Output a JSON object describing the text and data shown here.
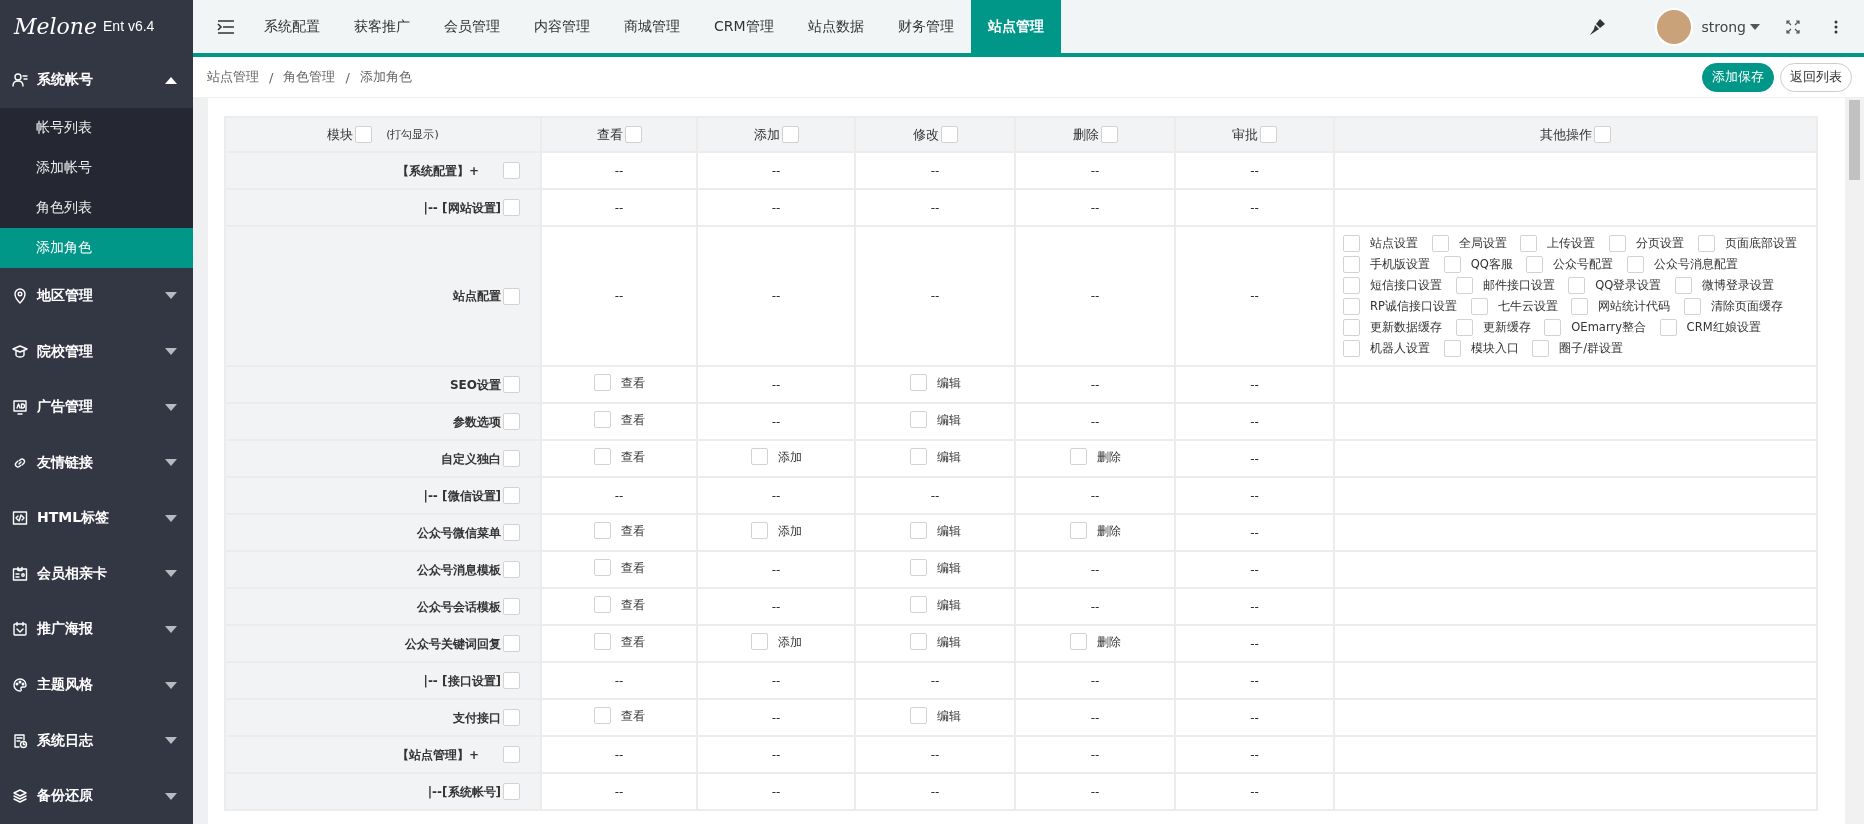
{
  "logo": {
    "script": "Melone",
    "version": "Ent v6.4"
  },
  "sidebar": {
    "items": [
      {
        "label": "系统帐号",
        "expanded": true,
        "children": [
          {
            "label": "帐号列表",
            "selected": false
          },
          {
            "label": "添加帐号",
            "selected": false
          },
          {
            "label": "角色列表",
            "selected": false
          },
          {
            "label": "添加角色",
            "selected": true
          }
        ]
      },
      {
        "label": "地区管理",
        "expanded": false
      },
      {
        "label": "院校管理",
        "expanded": false
      },
      {
        "label": "广告管理",
        "expanded": false
      },
      {
        "label": "友情链接",
        "expanded": false
      },
      {
        "label": "HTML标签",
        "expanded": false
      },
      {
        "label": "会员相亲卡",
        "expanded": false
      },
      {
        "label": "推广海报",
        "expanded": false
      },
      {
        "label": "主题风格",
        "expanded": false
      },
      {
        "label": "系统日志",
        "expanded": false
      },
      {
        "label": "备份还原",
        "expanded": false
      }
    ]
  },
  "topnav": {
    "tabs": [
      {
        "label": "系统配置",
        "selected": false
      },
      {
        "label": "获客推广",
        "selected": false
      },
      {
        "label": "会员管理",
        "selected": false
      },
      {
        "label": "内容管理",
        "selected": false
      },
      {
        "label": "商城管理",
        "selected": false
      },
      {
        "label": "CRM管理",
        "selected": false
      },
      {
        "label": "站点数据",
        "selected": false
      },
      {
        "label": "财务管理",
        "selected": false
      },
      {
        "label": "站点管理",
        "selected": true
      }
    ],
    "user": "strong"
  },
  "breadcrumb": [
    "站点管理",
    "/",
    "角色管理",
    "/",
    "添加角色"
  ],
  "buttons": [
    {
      "label": "添加保存",
      "kind": "primary"
    },
    {
      "label": "返回列表",
      "kind": "plain"
    }
  ],
  "table": {
    "columns": [
      {
        "label": "模块",
        "note": "(打勾显示)",
        "checked": false
      },
      {
        "label": "查看",
        "checked": false
      },
      {
        "label": "添加",
        "checked": false
      },
      {
        "label": "修改",
        "checked": false
      },
      {
        "label": "删除",
        "checked": false
      },
      {
        "label": "审批",
        "checked": false
      },
      {
        "label": "其他操作",
        "checked": false
      }
    ],
    "rows": [
      {
        "cells": [
          {
            "kind": "module",
            "text": "【系统配置】+",
            "group": true,
            "checked": false
          },
          {
            "kind": "dash",
            "text": "--"
          },
          {
            "kind": "dash",
            "text": "--"
          },
          {
            "kind": "dash",
            "text": "--"
          },
          {
            "kind": "dash",
            "text": "--"
          },
          {
            "kind": "dash",
            "text": "--"
          }
        ]
      },
      {
        "cells": [
          {
            "kind": "module",
            "text": "|-- [网站设置]",
            "group": false,
            "checked": false
          },
          {
            "kind": "dash",
            "text": "--"
          },
          {
            "kind": "dash",
            "text": "--"
          },
          {
            "kind": "dash",
            "text": "--"
          },
          {
            "kind": "dash",
            "text": "--"
          },
          {
            "kind": "dash",
            "text": "--"
          }
        ]
      },
      {
        "cells": [
          {
            "kind": "module",
            "text": "站点配置",
            "group": false,
            "checked": false
          },
          {
            "kind": "dash",
            "text": "--"
          },
          {
            "kind": "dash",
            "text": "--"
          },
          {
            "kind": "dash",
            "text": "--"
          },
          {
            "kind": "dash",
            "text": "--"
          },
          {
            "kind": "dash",
            "text": "--"
          },
          {
            "kind": "options",
            "options": [
              {
                "label": "站点设置",
                "checked": false
              },
              {
                "label": "全局设置",
                "checked": false
              },
              {
                "label": "上传设置",
                "checked": false
              },
              {
                "label": "分页设置",
                "checked": false
              },
              {
                "label": "页面底部设置",
                "checked": false
              },
              {
                "label": "手机版设置",
                "checked": false
              },
              {
                "label": "QQ客服",
                "checked": false
              },
              {
                "label": "公众号配置",
                "checked": false
              },
              {
                "label": "公众号消息配置",
                "checked": false
              },
              {
                "label": "短信接口设置",
                "checked": false
              },
              {
                "label": "邮件接口设置",
                "checked": false
              },
              {
                "label": "QQ登录设置",
                "checked": false
              },
              {
                "label": "微博登录设置",
                "checked": false
              },
              {
                "label": "RP诚信接口设置",
                "checked": false
              },
              {
                "label": "七牛云设置",
                "checked": false
              },
              {
                "label": "网站统计代码",
                "checked": false
              },
              {
                "label": "清除页面缓存",
                "checked": false
              },
              {
                "label": "更新数据缓存",
                "checked": false
              },
              {
                "label": "更新缓存",
                "checked": false
              },
              {
                "label": "OEmarry整合",
                "checked": false
              },
              {
                "label": "CRM红娘设置",
                "checked": false
              },
              {
                "label": "机器人设置",
                "checked": false
              },
              {
                "label": "模块入口",
                "checked": false
              },
              {
                "label": "圈子/群设置",
                "checked": false
              }
            ]
          }
        ]
      },
      {
        "cells": [
          {
            "kind": "module",
            "text": "SEO设置",
            "group": false,
            "checked": false
          },
          {
            "kind": "check",
            "label": "查看",
            "checked": false
          },
          {
            "kind": "dash",
            "text": "--"
          },
          {
            "kind": "check",
            "label": "编辑",
            "checked": false
          },
          {
            "kind": "dash",
            "text": "--"
          },
          {
            "kind": "dash",
            "text": "--"
          }
        ]
      },
      {
        "cells": [
          {
            "kind": "module",
            "text": "参数选项",
            "group": false,
            "checked": false
          },
          {
            "kind": "check",
            "label": "查看",
            "checked": false
          },
          {
            "kind": "dash",
            "text": "--"
          },
          {
            "kind": "check",
            "label": "编辑",
            "checked": false
          },
          {
            "kind": "dash",
            "text": "--"
          },
          {
            "kind": "dash",
            "text": "--"
          }
        ]
      },
      {
        "cells": [
          {
            "kind": "module",
            "text": "自定义独白",
            "group": false,
            "checked": false
          },
          {
            "kind": "check",
            "label": "查看",
            "checked": false
          },
          {
            "kind": "check",
            "label": "添加",
            "checked": false
          },
          {
            "kind": "check",
            "label": "编辑",
            "checked": false
          },
          {
            "kind": "check",
            "label": "删除",
            "checked": false
          },
          {
            "kind": "dash",
            "text": "--"
          }
        ]
      },
      {
        "cells": [
          {
            "kind": "module",
            "text": "|-- [微信设置]",
            "group": false,
            "checked": false
          },
          {
            "kind": "dash",
            "text": "--"
          },
          {
            "kind": "dash",
            "text": "--"
          },
          {
            "kind": "dash",
            "text": "--"
          },
          {
            "kind": "dash",
            "text": "--"
          },
          {
            "kind": "dash",
            "text": "--"
          }
        ]
      },
      {
        "cells": [
          {
            "kind": "module",
            "text": "公众号微信菜单",
            "group": false,
            "checked": false
          },
          {
            "kind": "check",
            "label": "查看",
            "checked": false
          },
          {
            "kind": "check",
            "label": "添加",
            "checked": false
          },
          {
            "kind": "check",
            "label": "编辑",
            "checked": false
          },
          {
            "kind": "check",
            "label": "删除",
            "checked": false
          },
          {
            "kind": "dash",
            "text": "--"
          }
        ]
      },
      {
        "cells": [
          {
            "kind": "module",
            "text": "公众号消息模板",
            "group": false,
            "checked": false
          },
          {
            "kind": "check",
            "label": "查看",
            "checked": false
          },
          {
            "kind": "dash",
            "text": "--"
          },
          {
            "kind": "check",
            "label": "编辑",
            "checked": false
          },
          {
            "kind": "dash",
            "text": "--"
          },
          {
            "kind": "dash",
            "text": "--"
          }
        ]
      },
      {
        "cells": [
          {
            "kind": "module",
            "text": "公众号会话模板",
            "group": false,
            "checked": false
          },
          {
            "kind": "check",
            "label": "查看",
            "checked": false
          },
          {
            "kind": "dash",
            "text": "--"
          },
          {
            "kind": "check",
            "label": "编辑",
            "checked": false
          },
          {
            "kind": "dash",
            "text": "--"
          },
          {
            "kind": "dash",
            "text": "--"
          }
        ]
      },
      {
        "cells": [
          {
            "kind": "module",
            "text": "公众号关键词回复",
            "group": false,
            "checked": false
          },
          {
            "kind": "check",
            "label": "查看",
            "checked": false
          },
          {
            "kind": "check",
            "label": "添加",
            "checked": false
          },
          {
            "kind": "check",
            "label": "编辑",
            "checked": false
          },
          {
            "kind": "check",
            "label": "删除",
            "checked": false
          },
          {
            "kind": "dash",
            "text": "--"
          }
        ]
      },
      {
        "cells": [
          {
            "kind": "module",
            "text": "|-- [接口设置]",
            "group": false,
            "checked": false
          },
          {
            "kind": "dash",
            "text": "--"
          },
          {
            "kind": "dash",
            "text": "--"
          },
          {
            "kind": "dash",
            "text": "--"
          },
          {
            "kind": "dash",
            "text": "--"
          },
          {
            "kind": "dash",
            "text": "--"
          }
        ]
      },
      {
        "cells": [
          {
            "kind": "module",
            "text": "支付接口",
            "group": false,
            "checked": false
          },
          {
            "kind": "check",
            "label": "查看",
            "checked": false
          },
          {
            "kind": "dash",
            "text": "--"
          },
          {
            "kind": "check",
            "label": "编辑",
            "checked": false
          },
          {
            "kind": "dash",
            "text": "--"
          },
          {
            "kind": "dash",
            "text": "--"
          }
        ]
      },
      {
        "cells": [
          {
            "kind": "module",
            "text": "【站点管理】+",
            "group": true,
            "checked": false
          },
          {
            "kind": "dash",
            "text": "--"
          },
          {
            "kind": "dash",
            "text": "--"
          },
          {
            "kind": "dash",
            "text": "--"
          },
          {
            "kind": "dash",
            "text": "--"
          },
          {
            "kind": "dash",
            "text": "--"
          }
        ]
      },
      {
        "cells": [
          {
            "kind": "module",
            "text": "|--[系统帐号]",
            "group": false,
            "checked": false
          },
          {
            "kind": "dash",
            "text": "--"
          },
          {
            "kind": "dash",
            "text": "--"
          },
          {
            "kind": "dash",
            "text": "--"
          },
          {
            "kind": "dash",
            "text": "--"
          },
          {
            "kind": "dash",
            "text": "--"
          }
        ]
      }
    ]
  }
}
